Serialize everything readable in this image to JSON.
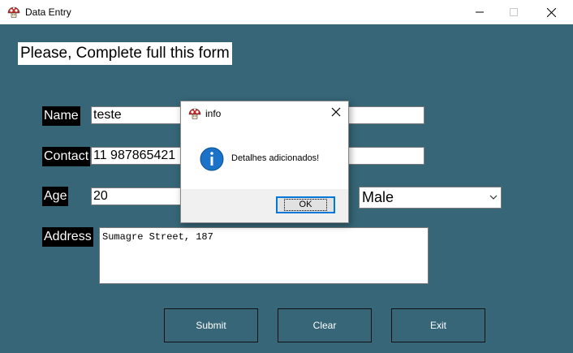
{
  "window": {
    "title": "Data Entry",
    "controls": {
      "minimize": "minimize",
      "maximize": "maximize",
      "close": "close"
    }
  },
  "form": {
    "heading": "Please, Complete full this form",
    "labels": {
      "name": "Name",
      "contact": "Contact",
      "age": "Age",
      "address": "Address"
    },
    "values": {
      "name": "teste",
      "contact": "11 987865421",
      "age": "20",
      "gender": "Male",
      "address": "Sumagre Street, 187"
    }
  },
  "buttons": {
    "submit": "Submit",
    "clear": "Clear",
    "exit": "Exit"
  },
  "dialog": {
    "title": "info",
    "message": "Detalhes adicionados!",
    "ok_label": "OK"
  },
  "colors": {
    "background": "#366677",
    "label_bg": "#000000",
    "dialog_accent": "#0078d7"
  },
  "icons": [
    "mushroom-icon",
    "info-icon",
    "close-icon",
    "chevron-down-icon"
  ]
}
